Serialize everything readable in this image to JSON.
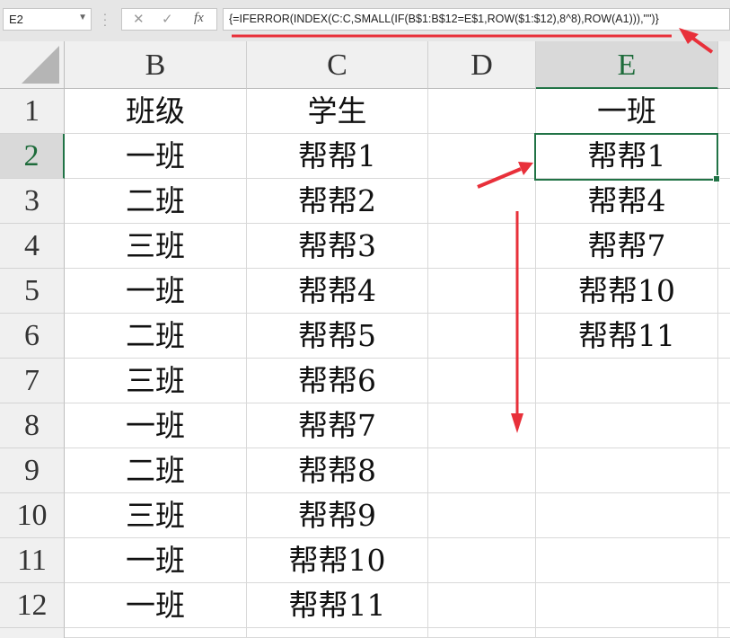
{
  "name_box": {
    "value": "E2"
  },
  "formula_bar": {
    "cancel_symbol": "✕",
    "confirm_symbol": "✓",
    "fx_label": "fx",
    "formula": "{=IFERROR(INDEX(C:C,SMALL(IF(B$1:B$12=E$1,ROW($1:$12),8^8),ROW(A1))),\"\")}"
  },
  "columns": [
    "B",
    "C",
    "D",
    "E"
  ],
  "active_column": "E",
  "rows": [
    "1",
    "2",
    "3",
    "4",
    "5",
    "6",
    "7",
    "8",
    "9",
    "10",
    "11",
    "12"
  ],
  "active_row": "2",
  "col_b": [
    "班级",
    "一班",
    "二班",
    "三班",
    "一班",
    "二班",
    "三班",
    "一班",
    "二班",
    "三班",
    "一班",
    "一班"
  ],
  "col_c": [
    "学生",
    "帮帮1",
    "帮帮2",
    "帮帮3",
    "帮帮4",
    "帮帮5",
    "帮帮6",
    "帮帮7",
    "帮帮8",
    "帮帮9",
    "帮帮10",
    "帮帮11"
  ],
  "col_e": [
    "一班",
    "帮帮1",
    "帮帮4",
    "帮帮7",
    "帮帮10",
    "帮帮11"
  ],
  "active_cell": "E2",
  "annotation_color": "#e8303a",
  "selection_color": "#217346"
}
